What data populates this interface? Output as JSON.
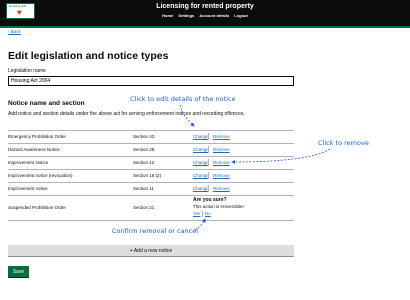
{
  "header": {
    "logo_text": "Housing Hub",
    "title": "Licensing for rented property",
    "nav": [
      "Home",
      "Settings",
      "Account details",
      "Logout"
    ]
  },
  "back_link": "Back",
  "page_title": "Edit legislation and notice types",
  "legislation": {
    "label": "Legislation name",
    "value": "Housing Act 2004"
  },
  "notices": {
    "heading": "Notice name and section",
    "hint": "Add notice and section details under the above act for serving enforcement notices and recording offences.",
    "change_label": "Change",
    "remove_label": "Remove",
    "rows": [
      {
        "name": "Emergency Prohibition Order",
        "section": "Section 43"
      },
      {
        "name": "Hazard Awareness Notice",
        "section": "Section 28"
      },
      {
        "name": "Improvement Notice",
        "section": "Section 12"
      },
      {
        "name": "Improvement notice (revocation)",
        "section": "Section 16 (2)"
      },
      {
        "name": "Improvement notice",
        "section": "Section 11"
      },
      {
        "name": "Suspended Prohibition Order",
        "section": "Section 21"
      }
    ]
  },
  "confirm": {
    "title": "Are you sure?",
    "text": "This action is irreversible!",
    "yes": "Yes",
    "no": "No"
  },
  "add_button": "+ Add a new notice",
  "save_button": "Save",
  "annotations": {
    "edit": "Click to edit details of the notice",
    "remove": "Click to remove",
    "confirm": "Confirm removal or cancel"
  },
  "colors": {
    "header": "#0b0c0c",
    "accent": "#00703c",
    "link": "#1d70b8",
    "annotation": "#1d5bd8"
  }
}
